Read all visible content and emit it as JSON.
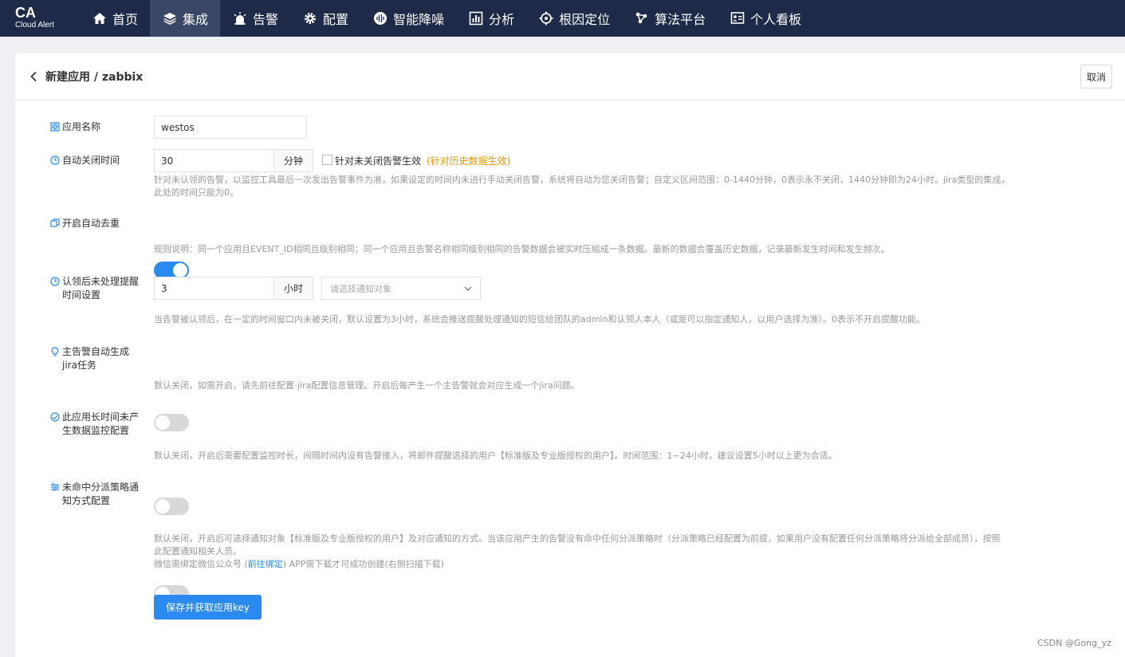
{
  "brand": {
    "title": "CA",
    "subtitle": "Cloud Alert"
  },
  "nav": {
    "items": [
      {
        "label": "首页",
        "icon": "home-icon"
      },
      {
        "label": "集成",
        "icon": "layers-icon",
        "active": true
      },
      {
        "label": "告警",
        "icon": "alarm-icon"
      },
      {
        "label": "配置",
        "icon": "gear-icon"
      },
      {
        "label": "智能降噪",
        "icon": "wave-icon"
      },
      {
        "label": "分析",
        "icon": "bar-chart-icon"
      },
      {
        "label": "根因定位",
        "icon": "target-icon"
      },
      {
        "label": "算法平台",
        "icon": "nodes-icon"
      },
      {
        "label": "个人看板",
        "icon": "dashboard-icon"
      }
    ]
  },
  "header": {
    "title": "新建应用 / zabbix",
    "cancel_label": "取消"
  },
  "form": {
    "app_name": {
      "label": "应用名称",
      "value": "westos"
    },
    "auto_close": {
      "label": "自动关闭时间",
      "value": "30",
      "unit": "分钟",
      "checkbox_label": "针对未关闭告警生效",
      "checkbox_note": "(针对历史数据生效)",
      "help1": "针对未认领的告警，以监控工具最后一次发出告警事件为准，如果设定的时间内未进行手动关闭告警，系统将自动为您关闭告警；自定义区间范围：0-1440分钟，0表示永不关闭，1440分钟即为24小时。jira类型的集成，",
      "help2": "此处的时间只能为0。"
    },
    "dedup": {
      "label": "开启自动去重",
      "enabled": true,
      "help": "规则说明：同一个应用且EVENT_ID相同且级别相同；同一个应用且告警名称相同级别相同的告警数据会被实时压缩成一条数据。最新的数据会覆盖历史数据，记录最新发生时间和发生频次。"
    },
    "reminder": {
      "label_line1": "认领后未处理提醒",
      "label_line2": "时间设置",
      "value": "3",
      "unit": "小时",
      "select_placeholder": "请选择通知对象",
      "help": "当告警被认领后，在一定的时间窗口内未被关闭，默认设置为3小时，系统会推送提醒处理通知的短信给团队的admin和认领人本人（或是可以指定通知人，以用户选择为准）。0表示不开启提醒功能。"
    },
    "jira": {
      "label_line1": "主告警自动生成",
      "label_line2": "jira任务",
      "enabled": false,
      "help": "默认关闭，如需开启，请先前往配置-jira配置信息管理。开启后每产生一个主告警就会对应生成一个jira问题。"
    },
    "no_data": {
      "label_line1": "此应用长时间未产",
      "label_line2": "生数据监控配置",
      "enabled": false,
      "help": "默认关闭，开启后需要配置监控时长，间隔时间内没有告警接入，将邮件提醒选择的用户【标准版及专业版授权的用户】。时间范围：1~24小时，建议设置5小时以上更为合适。"
    },
    "unmatched": {
      "label_line1": "未命中分派策略通",
      "label_line2": "知方式配置",
      "enabled": false,
      "help1": "默认关闭，开启后可选择通知对象【标准版及专业版授权的用户】及对应通知的方式。当该应用产生的告警没有命中任何分派策略时（分派策略已经配置为前提，如果用户没有配置任何分派策略将分派给全部成员），按照",
      "help2": "此配置通知相关人员。",
      "wechat_prefix": "微信需绑定微信公众号 (",
      "wechat_link": "前往绑定",
      "wechat_suffix": ") APP需下载才可成功创建(右侧扫描下载)"
    },
    "submit_label": "保存并获取应用key"
  },
  "watermark": "CSDN @Gong_yz",
  "colors": {
    "nav_bg": "#1e2a47",
    "primary": "#2b8af0",
    "orange": "#f29400"
  }
}
